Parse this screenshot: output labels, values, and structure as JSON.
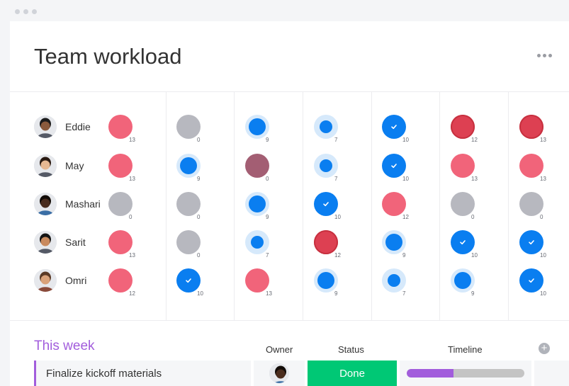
{
  "page": {
    "title": "Team workload",
    "more_icon": "more-horizontal-icon"
  },
  "colors": {
    "pink": "#f1647a",
    "crimson": "#dd4052",
    "gray": "#b7b8bf",
    "blue": "#0a7ef0",
    "mauve": "#a35e73",
    "halo": "#d6e9fb",
    "green": "#00c875",
    "purple": "#a25ddc"
  },
  "workload": {
    "people": [
      {
        "name": "Eddie",
        "avatar": "avatar-eddie",
        "cells": [
          {
            "count": "13",
            "state": "pink"
          },
          {
            "count": "0",
            "state": "gray"
          },
          {
            "count": "9",
            "state": "blue-halo"
          },
          {
            "count": "7",
            "state": "blue-small"
          },
          {
            "count": "10",
            "state": "blue-check"
          },
          {
            "count": "12",
            "state": "crimson"
          },
          {
            "count": "13",
            "state": "crimson"
          }
        ]
      },
      {
        "name": "May",
        "avatar": "avatar-may",
        "cells": [
          {
            "count": "13",
            "state": "pink"
          },
          {
            "count": "9",
            "state": "blue-halo"
          },
          {
            "count": "0",
            "state": "mauve"
          },
          {
            "count": "7",
            "state": "blue-small"
          },
          {
            "count": "10",
            "state": "blue-check"
          },
          {
            "count": "13",
            "state": "pink"
          },
          {
            "count": "13",
            "state": "pink"
          }
        ]
      },
      {
        "name": "Mashari",
        "avatar": "avatar-mashari",
        "cells": [
          {
            "count": "0",
            "state": "gray"
          },
          {
            "count": "0",
            "state": "gray"
          },
          {
            "count": "9",
            "state": "blue-halo"
          },
          {
            "count": "10",
            "state": "blue-check"
          },
          {
            "count": "12",
            "state": "pink"
          },
          {
            "count": "0",
            "state": "gray"
          },
          {
            "count": "0",
            "state": "gray"
          }
        ]
      },
      {
        "name": "Sarit",
        "avatar": "avatar-sarit",
        "cells": [
          {
            "count": "13",
            "state": "pink"
          },
          {
            "count": "0",
            "state": "gray"
          },
          {
            "count": "7",
            "state": "blue-small"
          },
          {
            "count": "12",
            "state": "crimson"
          },
          {
            "count": "9",
            "state": "blue-halo"
          },
          {
            "count": "10",
            "state": "blue-check"
          },
          {
            "count": "10",
            "state": "blue-check"
          }
        ]
      },
      {
        "name": "Omri",
        "avatar": "avatar-omri",
        "cells": [
          {
            "count": "12",
            "state": "pink"
          },
          {
            "count": "10",
            "state": "blue-check"
          },
          {
            "count": "13",
            "state": "pink"
          },
          {
            "count": "9",
            "state": "blue-halo"
          },
          {
            "count": "7",
            "state": "blue-small"
          },
          {
            "count": "9",
            "state": "blue-halo"
          },
          {
            "count": "10",
            "state": "blue-check"
          }
        ]
      }
    ]
  },
  "board": {
    "group_title": "This week",
    "columns": {
      "owner": "Owner",
      "status": "Status",
      "timeline": "Timeline"
    },
    "add_column_icon": "plus-circle-icon",
    "rows": [
      {
        "task": "Finalize kickoff materials",
        "owner_avatar": "avatar-mashari",
        "status": "Done",
        "timeline_progress": 0.4
      }
    ]
  }
}
